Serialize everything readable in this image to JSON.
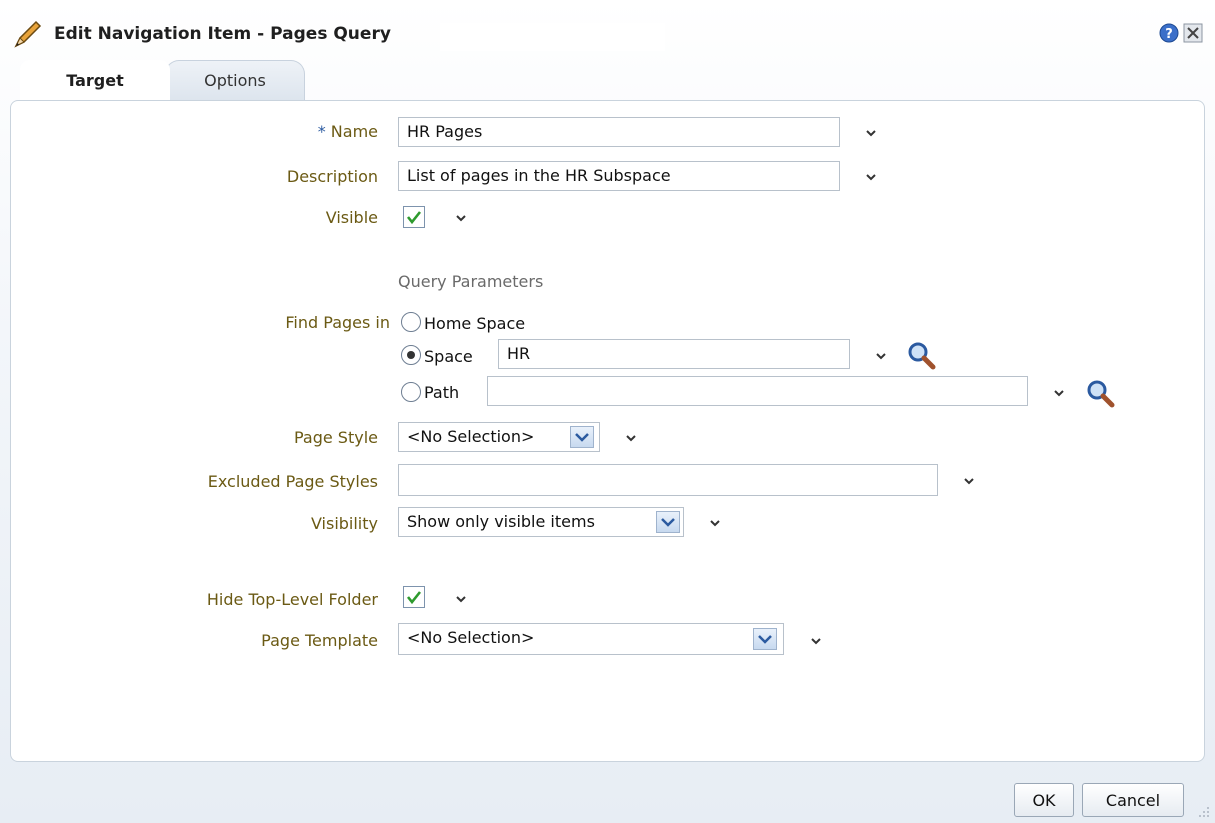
{
  "dialog": {
    "title": "Edit Navigation Item - Pages Query"
  },
  "tabs": [
    {
      "label": "Target",
      "active": true
    },
    {
      "label": "Options",
      "active": false
    }
  ],
  "form": {
    "name": {
      "label": "Name",
      "required_marker": "*",
      "value": "HR Pages"
    },
    "description": {
      "label": "Description",
      "value": "List of pages in the HR Subspace"
    },
    "visible": {
      "label": "Visible",
      "checked": true
    },
    "query_parameters_title": "Query Parameters",
    "find_pages_in": {
      "label": "Find Pages in",
      "options": [
        {
          "label": "Home Space",
          "selected": false
        },
        {
          "label": "Space",
          "selected": true,
          "value": "HR"
        },
        {
          "label": "Path",
          "selected": false,
          "value": ""
        }
      ]
    },
    "page_style": {
      "label": "Page Style",
      "value": "<No Selection>"
    },
    "excluded_page_styles": {
      "label": "Excluded Page Styles",
      "value": ""
    },
    "visibility": {
      "label": "Visibility",
      "value": "Show only visible items"
    },
    "hide_top_level_folder": {
      "label": "Hide Top-Level Folder",
      "checked": true
    },
    "page_template": {
      "label": "Page Template",
      "value": "<No Selection>"
    }
  },
  "buttons": {
    "ok": "OK",
    "cancel": "Cancel"
  },
  "colors": {
    "label": "#6b5a14",
    "accent": "#2b5aa0",
    "check": "#2e9a2e"
  }
}
